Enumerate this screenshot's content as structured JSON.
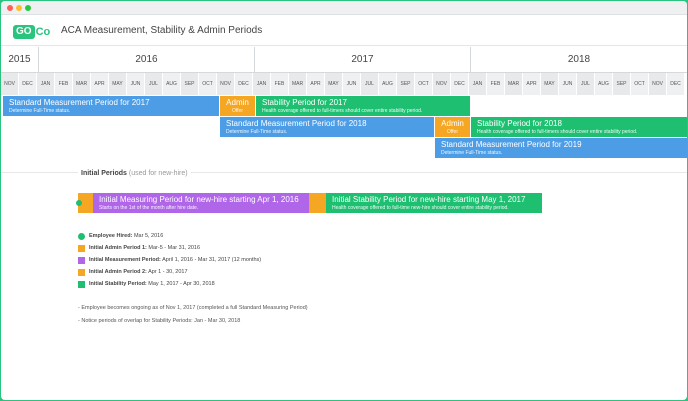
{
  "header": {
    "logo_go": "GO",
    "logo_co": "Co",
    "title": "ACA Measurement, Stability & Admin Periods"
  },
  "timeline": {
    "years": [
      "2015",
      "2016",
      "2017",
      "2018"
    ],
    "months": [
      "NOV",
      "DEC",
      "JAN",
      "FEB",
      "MAR",
      "APR",
      "MAY",
      "JUN",
      "JUL",
      "AUG",
      "SEP",
      "OCT",
      "NOV",
      "DEC",
      "JAN",
      "FEB",
      "MAR",
      "APR",
      "MAY",
      "JUN",
      "JUL",
      "AUG",
      "SEP",
      "OCT",
      "NOV",
      "DEC",
      "JAN",
      "FEB",
      "MAR",
      "APR",
      "MAY",
      "JUN",
      "JUL",
      "AUG",
      "SEP",
      "OCT",
      "NOV",
      "DEC"
    ]
  },
  "periods": {
    "smp2017": {
      "title": "Standard Measurement Period for 2017",
      "sub": "Determine Full-Time status."
    },
    "admin1": {
      "title": "Admin",
      "sub": "Offer"
    },
    "sp2017": {
      "title": "Stability Period for 2017",
      "sub": "Health coverage offered to full-timers should cover entire stability period."
    },
    "smp2018": {
      "title": "Standard Measurement Period for 2018",
      "sub": "Determine Full-Time status."
    },
    "admin2": {
      "title": "Admin",
      "sub": "Offer"
    },
    "sp2018": {
      "title": "Stability Period for 2018",
      "sub": "Health coverage offered to full-timers should cover entire stability period."
    },
    "smp2019": {
      "title": "Standard Measurement Period for 2019",
      "sub": "Determine Full-Time status."
    }
  },
  "initial": {
    "title": "Initial Periods",
    "subtitle": "(used for new-hire)",
    "imp": {
      "title": "Initial Measuring Period for new-hire starting Apr 1, 2016",
      "sub": "Starts on the 1st of the month after hire date."
    },
    "isp": {
      "title": "Initial Stability Period for new-hire starting May 1, 2017",
      "sub": "Health coverage offered to full-time new-hire should cover entire stability period."
    }
  },
  "legend": [
    {
      "label": "Employee Hired:",
      "value": "Mar 5, 2016",
      "color": "#1fbf72"
    },
    {
      "label": "Initial Admin Period 1:",
      "value": "Mar-5 - Mar 31, 2016",
      "color": "#f5a623"
    },
    {
      "label": "Initial Measurement Period:",
      "value": "April 1, 2016 - Mar 31, 2017 (12 months)",
      "color": "#b066e8"
    },
    {
      "label": "Initial Admin Period 2:",
      "value": "Apr 1 - 30, 2017",
      "color": "#f5a623"
    },
    {
      "label": "Initial Stability Period:",
      "value": "May 1, 2017 - Apr 30, 2018",
      "color": "#1fbf72"
    }
  ],
  "notes": [
    "- Employee becomes ongoing as of Nov 1, 2017 (completed a full Standard Measuring Period)",
    "- Notice periods of overlap for Stability Periods: Jan - Mar 30, 2018"
  ],
  "colors": {
    "brand": "#2bc47e",
    "measurement": "#4c9de6",
    "admin": "#f5a623",
    "stability": "#1fbf72",
    "initial_measurement": "#b066e8"
  }
}
